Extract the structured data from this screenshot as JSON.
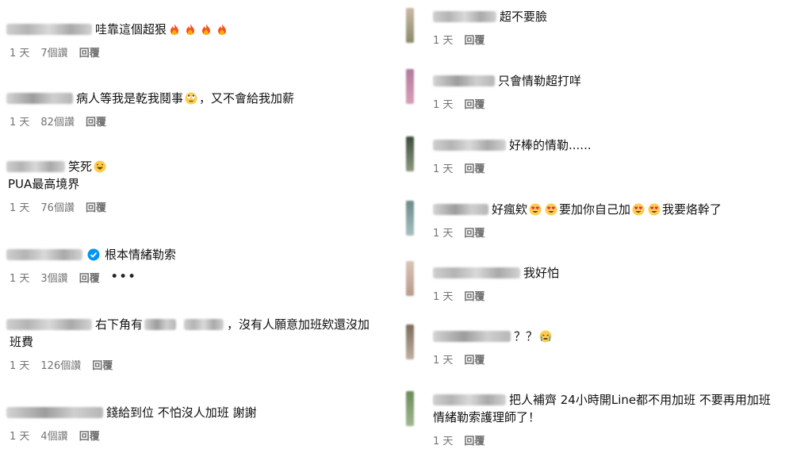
{
  "left": [
    {
      "text_a": "哇靠這個超狠",
      "emojis": [
        "fire",
        "fire",
        "fire",
        "fire"
      ],
      "text_b": "",
      "time": "1 天",
      "likes": "7個讚",
      "reply": "回覆"
    },
    {
      "text_a": "病人等我是乾我鬩事",
      "emojis": [
        "eyeroll"
      ],
      "text_b": "，又不會給我加薪",
      "time": "1 天",
      "likes": "82個讚",
      "reply": "回覆"
    },
    {
      "text_a": "笑死",
      "emojis": [
        "grin"
      ],
      "text_b": "",
      "cont": "PUA最高境界",
      "time": "1 天",
      "likes": "76個讚",
      "reply": "回覆"
    },
    {
      "text_a": "根本情緒勒索",
      "emojis": [],
      "text_b": "",
      "time": "1 天",
      "likes": "3個讚",
      "reply": "回覆",
      "more": "•••"
    },
    {
      "text_a": "右下角有",
      "text_b": "，沒有人願意加班欸還沒加",
      "cont": "班費",
      "time": "1 天",
      "likes": "126個讚",
      "reply": "回覆"
    },
    {
      "text_a": "錢給到位 不怕沒人加班 謝謝",
      "emojis": [],
      "text_b": "",
      "time": "1 天",
      "likes": "4個讚",
      "reply": "回覆"
    }
  ],
  "right": [
    {
      "text_a": "超不要臉",
      "time": "1 天",
      "reply": "回覆"
    },
    {
      "text_a": "只會情勒超打咩",
      "time": "1 天",
      "reply": "回覆"
    },
    {
      "text_a": "好棒的情勒......",
      "time": "1 天",
      "reply": "回覆"
    },
    {
      "text_a": "好瘋欸",
      "text_b": "要加你自己加",
      "text_c": "我要烙幹了",
      "time": "1 天",
      "reply": "回覆"
    },
    {
      "text_a": "我好怕",
      "time": "1 天",
      "reply": "回覆"
    },
    {
      "text_a": "？？",
      "time": "1 天",
      "reply": "回覆"
    },
    {
      "text_a": "把人補齊 24小時開Line都不用加班 不要再用加班",
      "cont": "情緒勒索護理師了！",
      "time": "1 天",
      "reply": "回覆"
    }
  ],
  "colors": {
    "meta": "#737373",
    "verified": "#0095f6",
    "text": "#111111"
  }
}
